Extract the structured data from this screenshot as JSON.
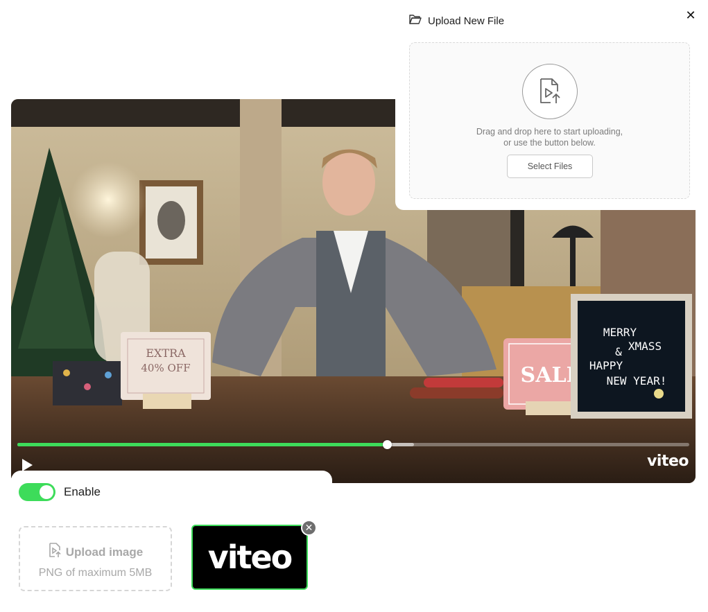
{
  "upload_panel": {
    "title": "Upload New File",
    "close_symbol": "✕",
    "drop_text_line1": "Drag and drop here to start uploading,",
    "drop_text_line2": "or use the button below.",
    "select_button": "Select Files",
    "icons": {
      "header": "folder-open-icon",
      "drop": "video-file-upload-icon"
    }
  },
  "player": {
    "logo_text": "viteo",
    "progress_fraction": 0.55,
    "buffered_fraction": 0.59,
    "state": "paused",
    "scene_signs": {
      "left_sign_line1": "EXTRA",
      "left_sign_line2": "40% OFF",
      "sale_sign": "SALE",
      "board_line1": "MERRY",
      "board_line2": "XMASS",
      "board_line3": "&",
      "board_line4": "HAPPY",
      "board_line5": "NEW YEAR!"
    },
    "accent_color": "#3ddc5a"
  },
  "watermark_settings": {
    "toggle_label": "Enable",
    "toggle_on": true,
    "upload_label": "Upload image",
    "upload_hint": "PNG of maximum 5MB",
    "uploaded_logo_text": "viteo",
    "remove_symbol": "✕"
  }
}
